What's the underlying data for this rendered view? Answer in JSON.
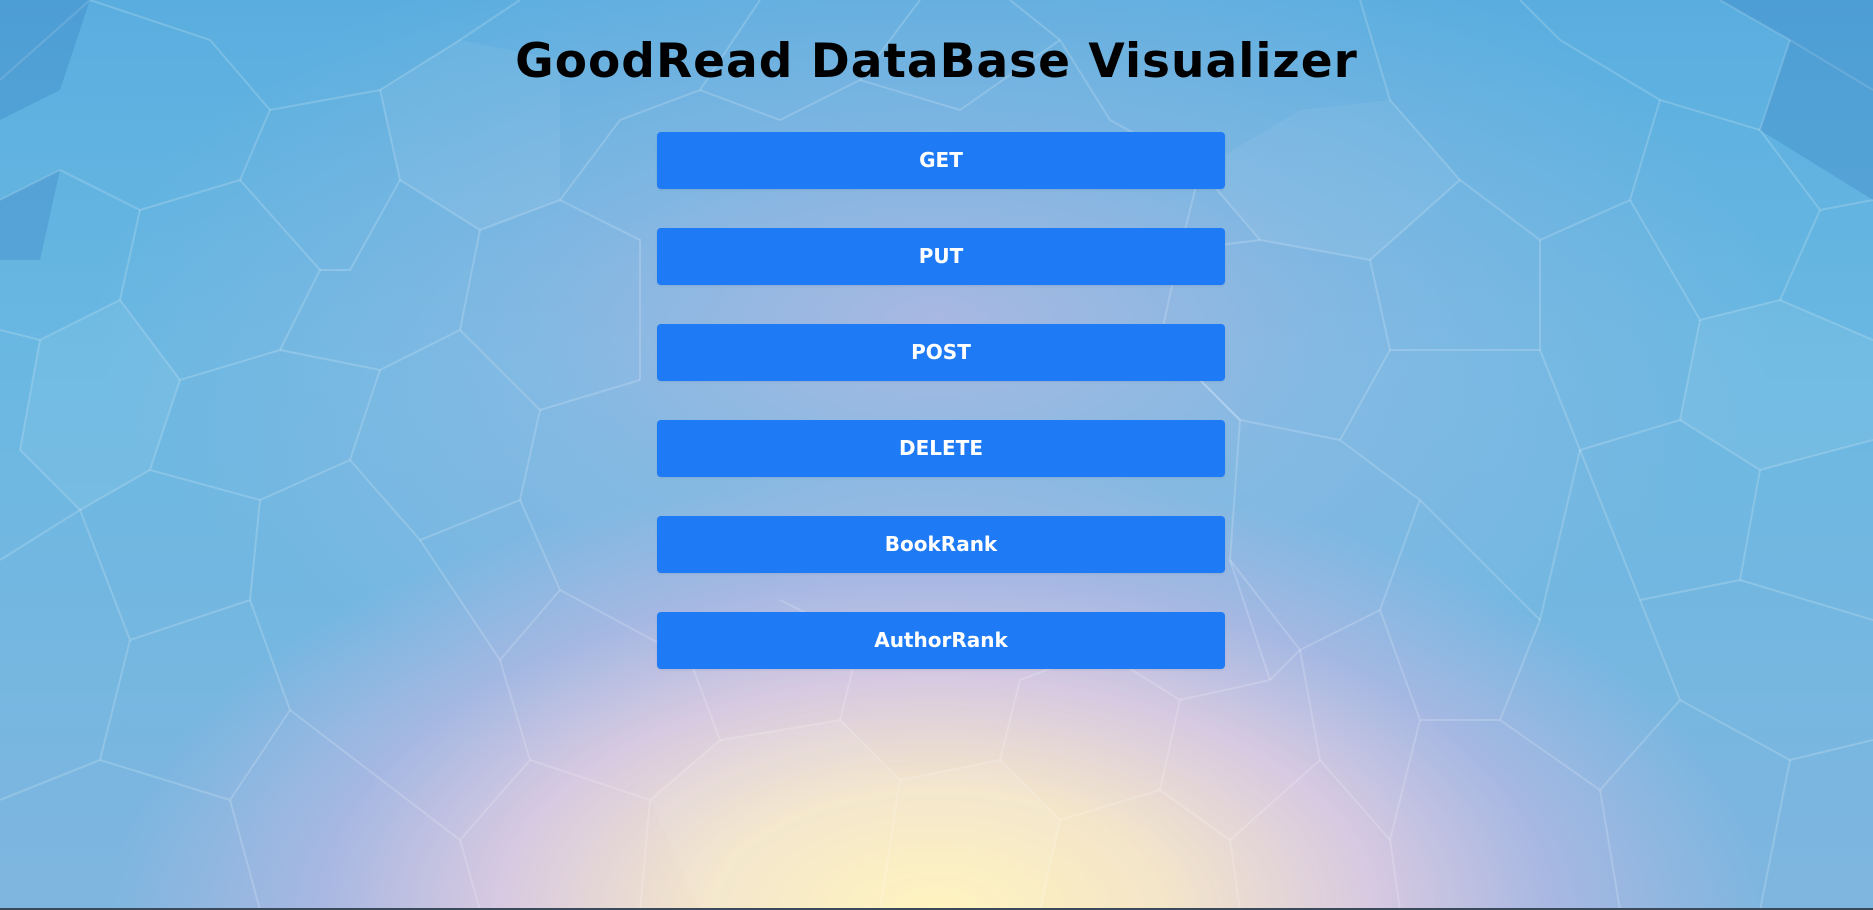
{
  "page": {
    "title": "GoodRead DataBase Visualizer"
  },
  "buttons": {
    "get": "GET",
    "put": "PUT",
    "post": "POST",
    "delete": "DELETE",
    "book_rank": "BookRank",
    "author_rank": "AuthorRank"
  },
  "colors": {
    "button_background": "#1f7af5",
    "button_text": "#ffffff",
    "title_text": "#000000",
    "background_blue": "#5aaedf",
    "background_pink": "#dcb9e1",
    "background_yellow": "#fff3ba"
  }
}
